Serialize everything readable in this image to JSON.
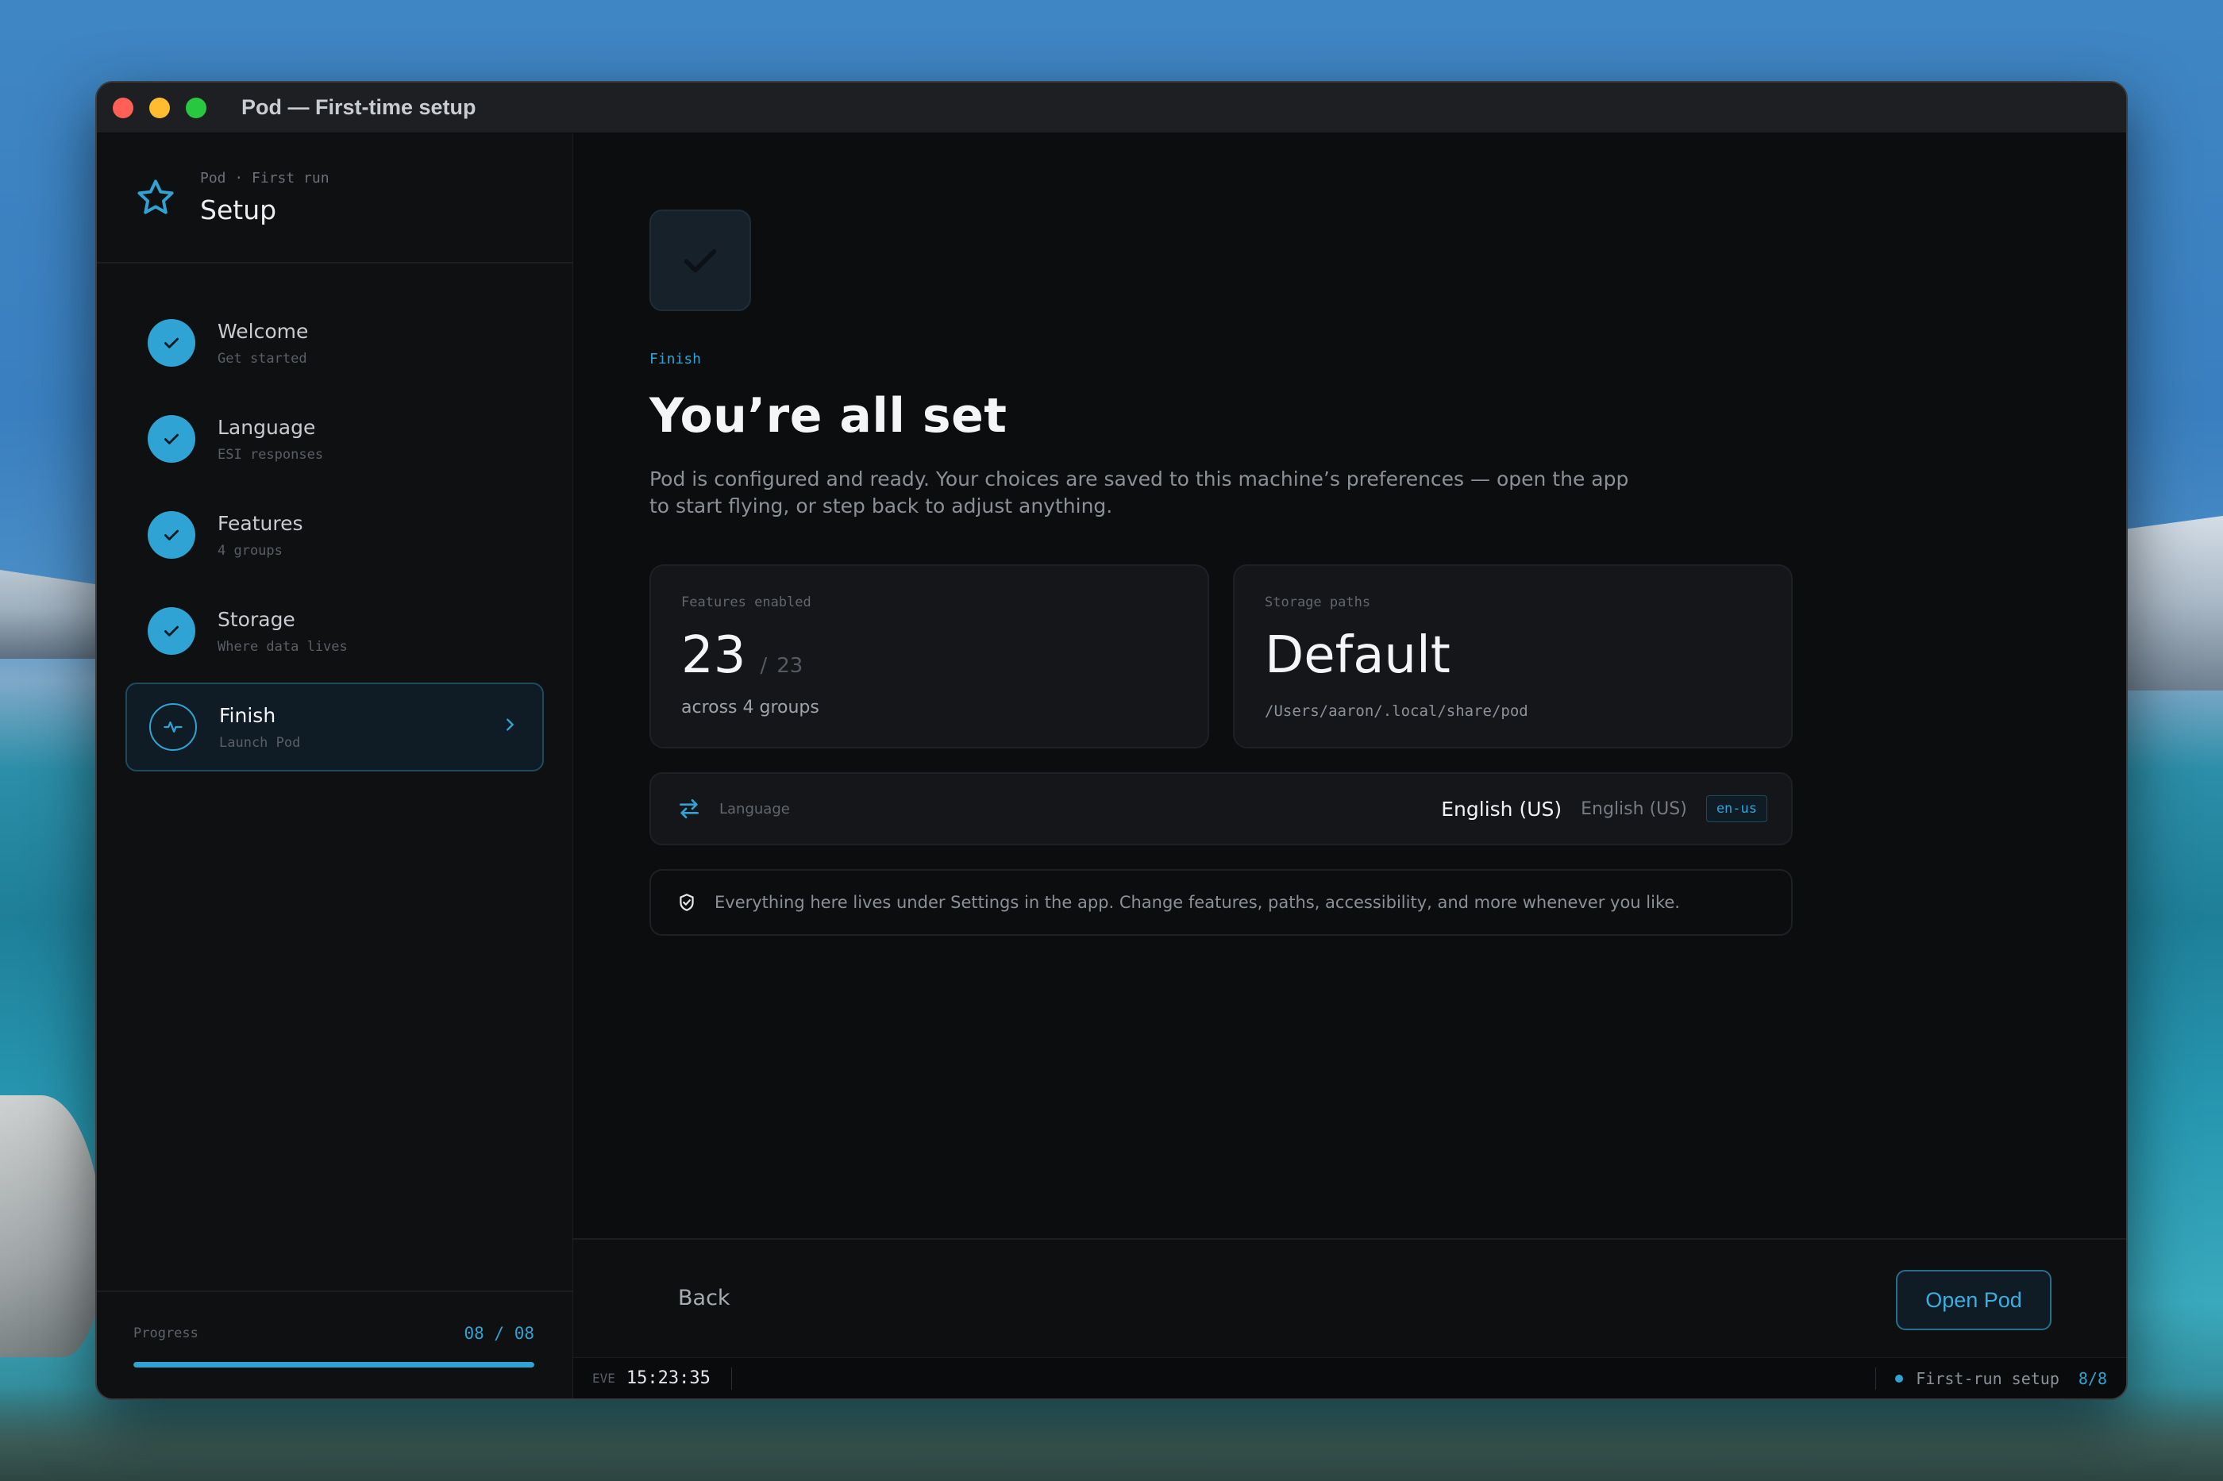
{
  "window": {
    "title": "Pod — First-time setup"
  },
  "brand": {
    "eyebrow": "Pod · First run",
    "title": "Setup"
  },
  "steps": [
    {
      "label": "Welcome",
      "sub": "Get started",
      "state": "done"
    },
    {
      "label": "Language",
      "sub": "ESI responses",
      "state": "done"
    },
    {
      "label": "Features",
      "sub": "4 groups",
      "state": "done"
    },
    {
      "label": "Storage",
      "sub": "Where data lives",
      "state": "done"
    },
    {
      "label": "Finish",
      "sub": "Launch Pod",
      "state": "active"
    }
  ],
  "progress": {
    "label": "Progress",
    "count": "08 / 08",
    "fraction": 1.0
  },
  "main": {
    "eyebrow": "Finish",
    "headline": "You’re all set",
    "description": "Pod is configured and ready. Your choices are saved to this machine’s preferences — open the app to start flying, or step back to adjust anything.",
    "features_card": {
      "label": "Features enabled",
      "value": "23",
      "separator": "/",
      "total": "23",
      "caption": "across 4 groups"
    },
    "storage_card": {
      "label": "Storage paths",
      "value": "Default",
      "path": "/Users/aaron/.local/share/pod"
    },
    "language_row": {
      "label": "Language",
      "value": "English (US)",
      "native": "English (US)",
      "code": "en-us"
    },
    "note": "Everything here lives under Settings in the app. Change features, paths, accessibility, and more whenever you like."
  },
  "footer": {
    "back_label": "Back",
    "primary_label": "Open Pod"
  },
  "statusbar": {
    "prefix": "EVE",
    "time": "15:23:35",
    "label": "First-run setup",
    "count": "8/8"
  },
  "colors": {
    "accent": "#2fa3d3",
    "background": "#0c0d0f",
    "card": "#141619"
  },
  "icons": {
    "brand": "star-icon",
    "done": "check-icon",
    "active": "pulse-icon",
    "chevron": "chevron-right-icon",
    "language": "swap-arrows-icon",
    "note": "shield-check-icon"
  }
}
